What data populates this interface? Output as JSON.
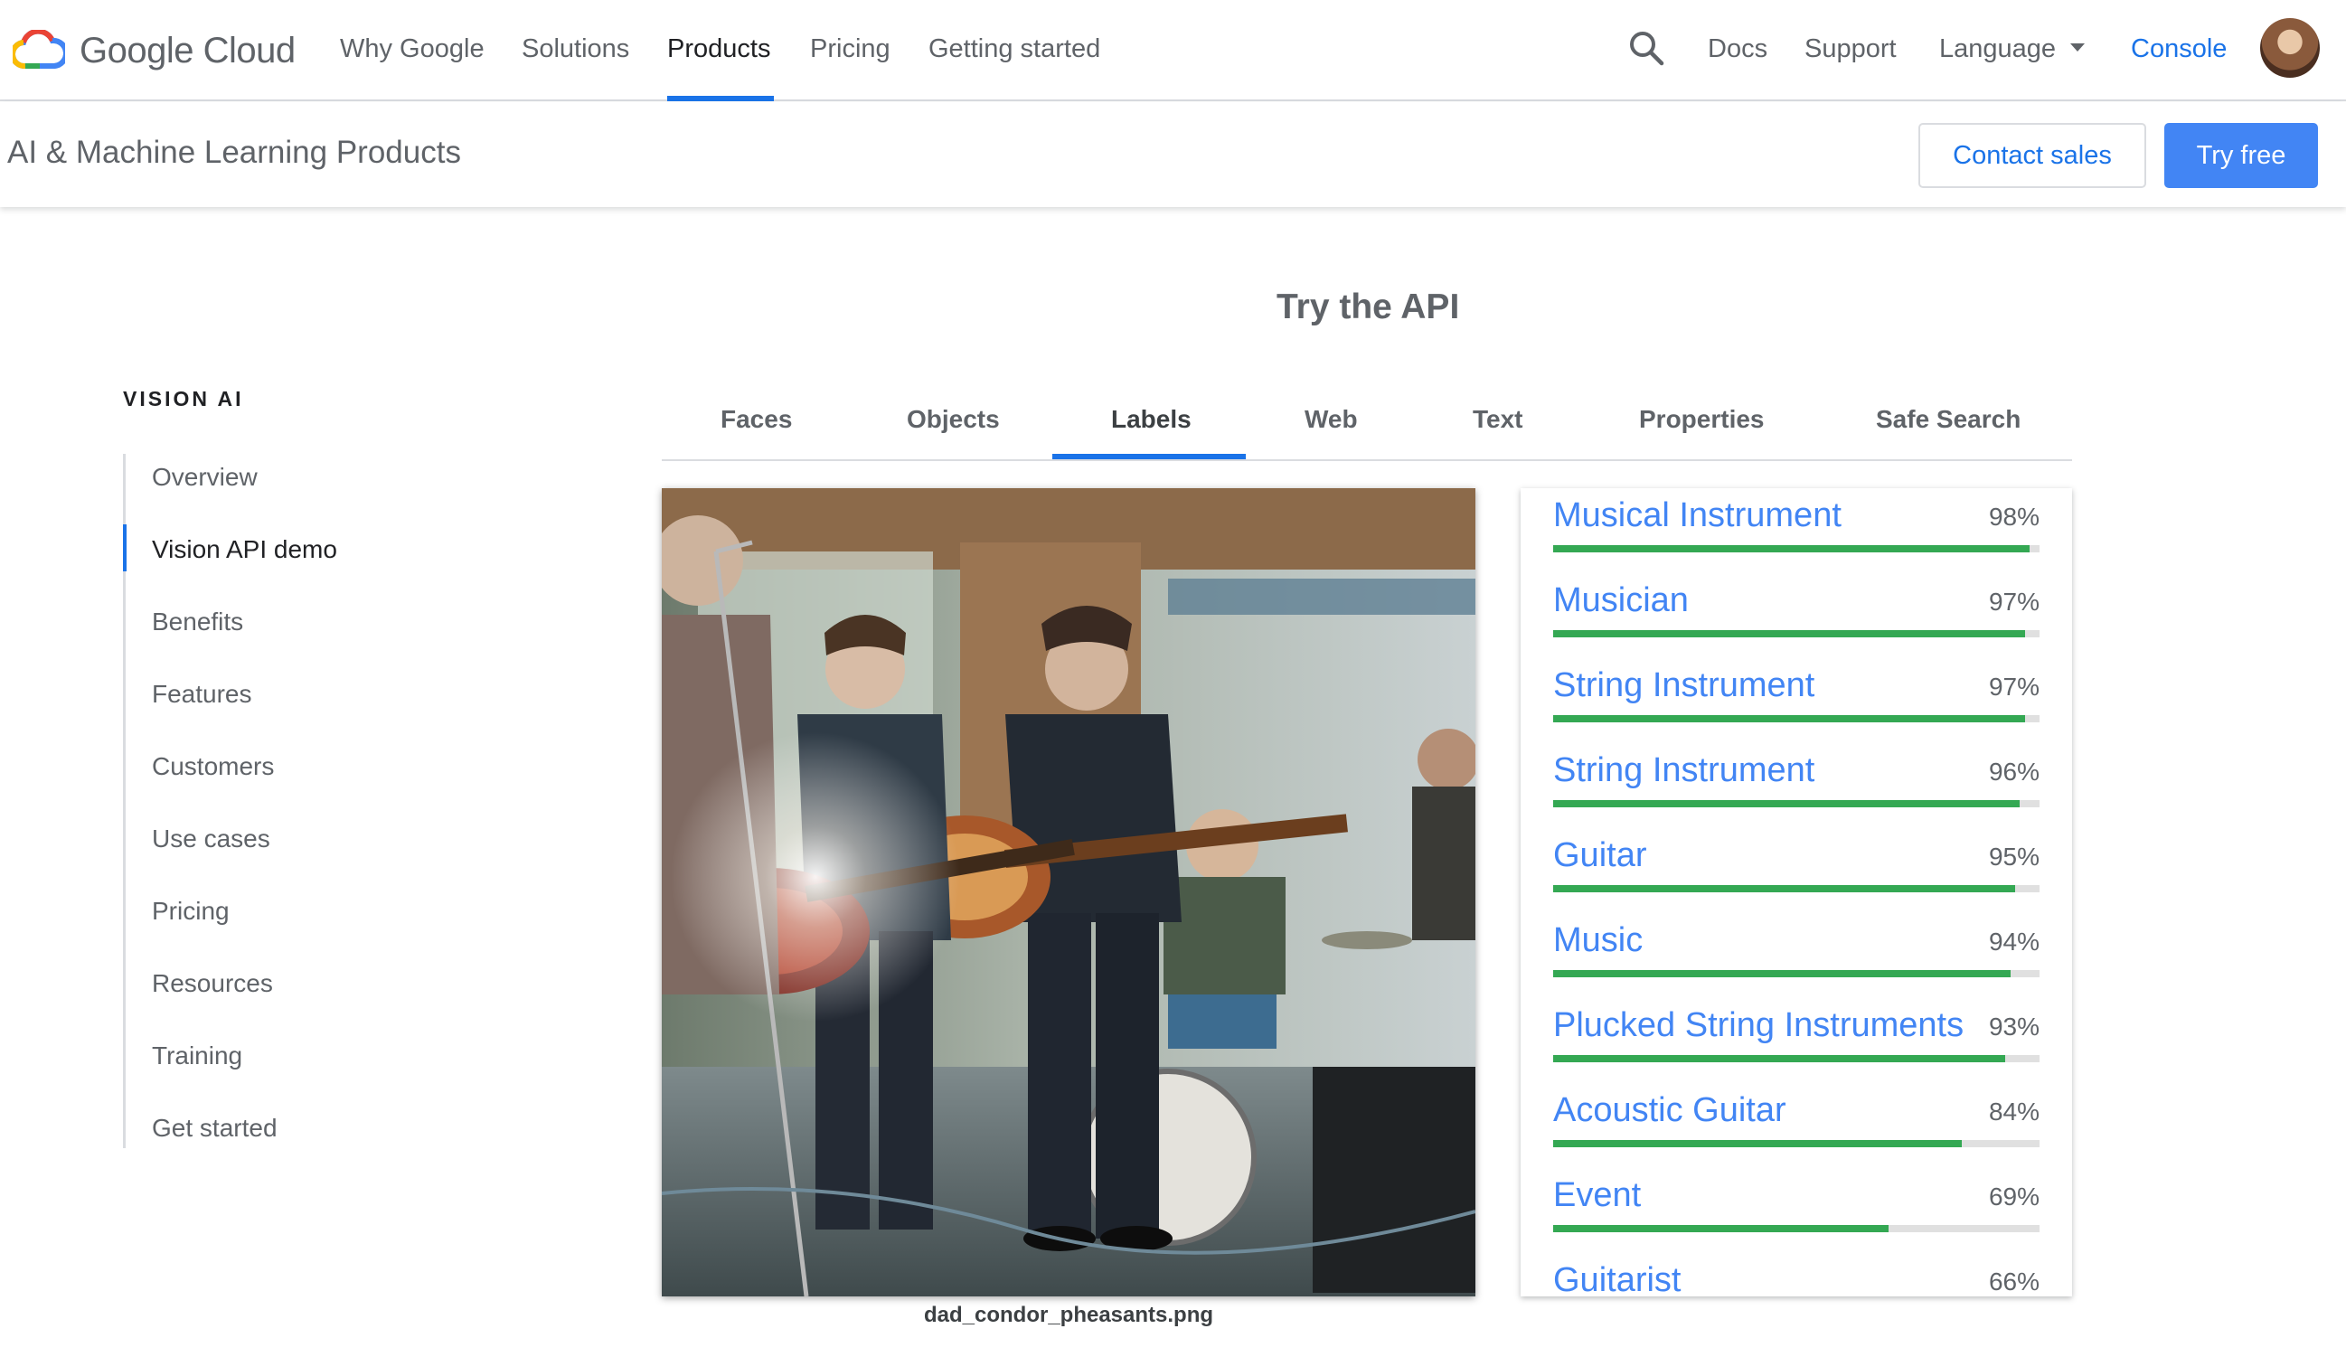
{
  "brand": {
    "logo_text": "Google Cloud"
  },
  "topnav": {
    "links": [
      "Why Google",
      "Solutions",
      "Products",
      "Pricing",
      "Getting started"
    ],
    "active": "Products",
    "docs": "Docs",
    "support": "Support",
    "language": "Language",
    "console": "Console"
  },
  "subheader": {
    "title": "AI & Machine Learning Products",
    "contact_sales": "Contact sales",
    "try_free": "Try free"
  },
  "sidebar": {
    "heading": "VISION AI",
    "items": [
      "Overview",
      "Vision API demo",
      "Benefits",
      "Features",
      "Customers",
      "Use cases",
      "Pricing",
      "Resources",
      "Training",
      "Get started"
    ],
    "active": "Vision API demo"
  },
  "demo": {
    "title": "Try the API",
    "tabs": [
      "Faces",
      "Objects",
      "Labels",
      "Web",
      "Text",
      "Properties",
      "Safe Search"
    ],
    "active_tab": "Labels",
    "image_caption": "dad_condor_pheasants.png",
    "labels": [
      {
        "name": "Musical Instrument",
        "score": "98%",
        "value": 0.98
      },
      {
        "name": "Musician",
        "score": "97%",
        "value": 0.97
      },
      {
        "name": "String Instrument",
        "score": "97%",
        "value": 0.97
      },
      {
        "name": "String Instrument",
        "score": "96%",
        "value": 0.96
      },
      {
        "name": "Guitar",
        "score": "95%",
        "value": 0.95
      },
      {
        "name": "Music",
        "score": "94%",
        "value": 0.94
      },
      {
        "name": "Plucked String Instruments",
        "score": "93%",
        "value": 0.93
      },
      {
        "name": "Acoustic Guitar",
        "score": "84%",
        "value": 0.84
      },
      {
        "name": "Event",
        "score": "69%",
        "value": 0.69
      },
      {
        "name": "Guitarist",
        "score": "66%",
        "value": 0.66
      }
    ]
  },
  "colors": {
    "accent": "#1a73e8",
    "label_blue": "#4285f4",
    "bar_green": "#34a853",
    "bar_track": "#e0e0e0"
  },
  "icons": [
    "google-cloud-logo-icon",
    "search-icon",
    "caret-down-icon",
    "avatar"
  ]
}
